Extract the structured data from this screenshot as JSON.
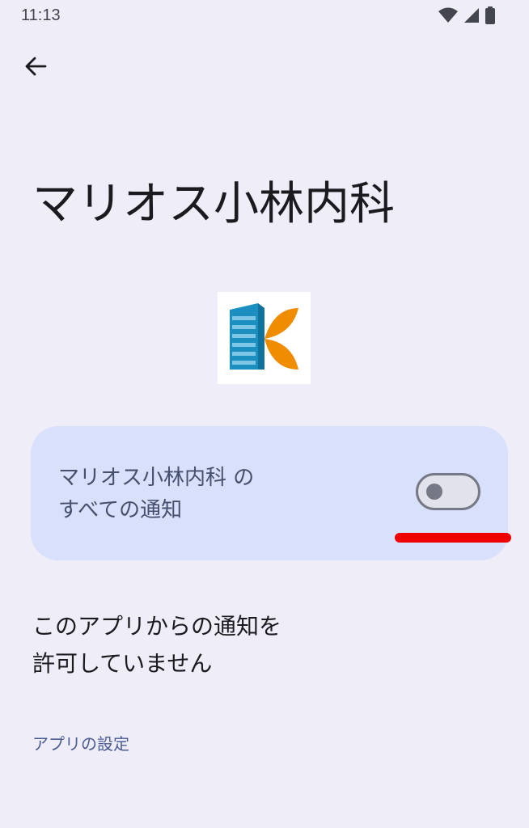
{
  "status_bar": {
    "time": "11:13",
    "icons": [
      "wifi-icon",
      "signal-icon",
      "battery-icon"
    ]
  },
  "header": {
    "back_icon": "arrow-left-icon"
  },
  "app": {
    "title": "マリオス小林内科",
    "icon": "clinic-logo-icon",
    "colors": {
      "logo_blue": "#1a8fc0",
      "logo_orange": "#f08c00"
    }
  },
  "notification_toggle": {
    "label_line1": "マリオス小林内科 の",
    "label_line2": "すべての通知",
    "state": "off",
    "annotation_color": "#ee0000"
  },
  "description": {
    "line1": "このアプリからの通知を",
    "line2": "許可していません"
  },
  "app_settings": {
    "label": "アプリの設定"
  },
  "theme": {
    "background": "#efeef8",
    "card": "#d9e0fb",
    "link": "#4a5c94"
  }
}
